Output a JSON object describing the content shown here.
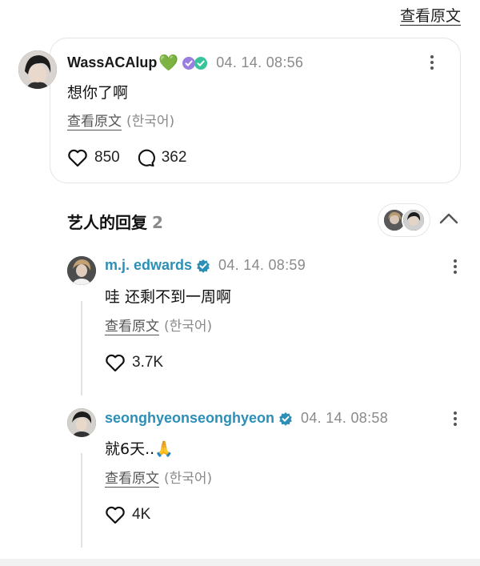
{
  "header": {
    "view_original": "查看原文"
  },
  "post": {
    "username": "WassACAlup",
    "emoji": "💚",
    "timestamp": "04. 14. 08:56",
    "content": "想你了啊",
    "translate_link": "查看原文",
    "translate_lang": "(한국어)",
    "likes": "850",
    "comments": "362"
  },
  "replies_section": {
    "title": "艺人的回复",
    "count": "2"
  },
  "replies": [
    {
      "username": "m.j. edwards",
      "timestamp": "04. 14. 08:59",
      "content": "哇 还剩不到一周啊",
      "translate_link": "查看原文",
      "translate_lang": "(한국어)",
      "likes": "3.7K"
    },
    {
      "username": "seonghyeonseonghyeon",
      "timestamp": "04. 14. 08:58",
      "content": "就6天..🙏",
      "translate_link": "查看原文",
      "translate_lang": "(한국어)",
      "likes": "4K"
    }
  ],
  "colors": {
    "verified_blue": "#2c8fb5",
    "green_heart": "#2bc45a",
    "muted_text": "#8a8a8a"
  },
  "icons": [
    "heart-icon",
    "comment-icon",
    "more-icon",
    "verified-icon",
    "chevron-up-icon"
  ]
}
